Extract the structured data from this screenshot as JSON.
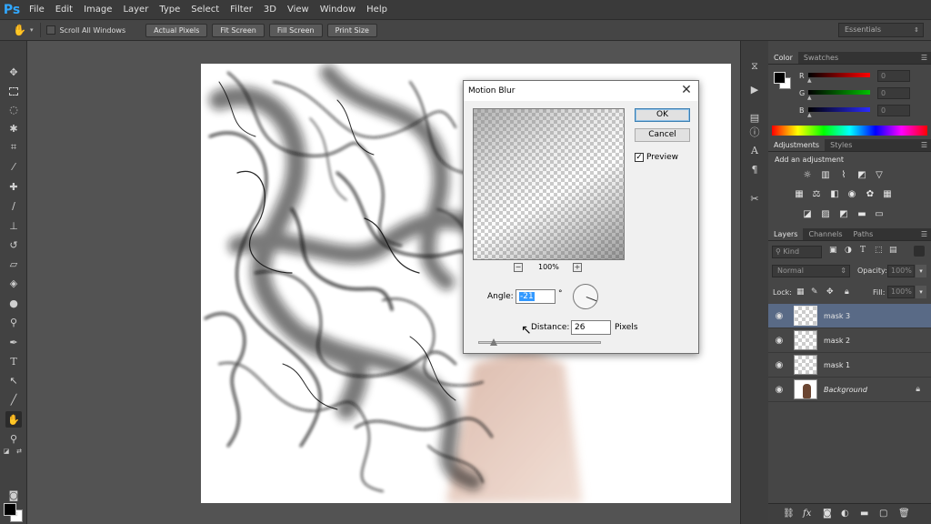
{
  "app": {
    "logo": "Ps",
    "menu": [
      "File",
      "Edit",
      "Image",
      "Layer",
      "Type",
      "Select",
      "Filter",
      "3D",
      "View",
      "Window",
      "Help"
    ]
  },
  "options_bar": {
    "tool_icon": "hand-icon",
    "scroll_all_windows": "Scroll All Windows",
    "buttons": [
      "Actual Pixels",
      "Fit Screen",
      "Fill Screen",
      "Print Size"
    ],
    "workspace": "Essentials"
  },
  "toolbar": {
    "tools": [
      "move",
      "marquee",
      "lasso",
      "quick-select",
      "crop",
      "eyedropper",
      "healing",
      "brush",
      "stamp",
      "history-brush",
      "eraser",
      "gradient",
      "blur",
      "dodge",
      "pen",
      "type",
      "path-select",
      "shape",
      "hand",
      "zoom"
    ],
    "active_tool": "hand",
    "foreground_color": "#000000",
    "background_color": "#ffffff"
  },
  "color_panel": {
    "tabs": [
      "Color",
      "Swatches"
    ],
    "channels": [
      {
        "label": "R",
        "value": "0"
      },
      {
        "label": "G",
        "value": "0"
      },
      {
        "label": "B",
        "value": "0"
      }
    ]
  },
  "adjustments_panel": {
    "tabs": [
      "Adjustments",
      "Styles"
    ],
    "heading": "Add an adjustment"
  },
  "layers_panel": {
    "tabs": [
      "Layers",
      "Channels",
      "Paths"
    ],
    "kind": "Kind",
    "blend_mode": "Normal",
    "opacity_label": "Opacity:",
    "opacity_value": "100%",
    "lock_label": "Lock:",
    "fill_label": "Fill:",
    "fill_value": "100%",
    "layers": [
      {
        "name": "mask 3",
        "selected": true
      },
      {
        "name": "mask 2",
        "selected": false
      },
      {
        "name": "mask 1",
        "selected": false
      },
      {
        "name": "Background",
        "selected": false,
        "locked": true
      }
    ],
    "footer_icons": [
      "link-icon",
      "fx-icon",
      "mask-icon",
      "adjustment-icon",
      "group-icon",
      "new-layer-icon",
      "trash-icon"
    ]
  },
  "motion_blur_dialog": {
    "title": "Motion Blur",
    "ok_label": "OK",
    "cancel_label": "Cancel",
    "preview_label": "Preview",
    "preview_checked": true,
    "zoom_out": "−",
    "zoom_in": "+",
    "zoom_level": "100%",
    "angle_label": "Angle:",
    "angle_value": "-21",
    "angle_unit": "°",
    "distance_label": "Distance:",
    "distance_value": "26",
    "distance_unit": "Pixels"
  }
}
